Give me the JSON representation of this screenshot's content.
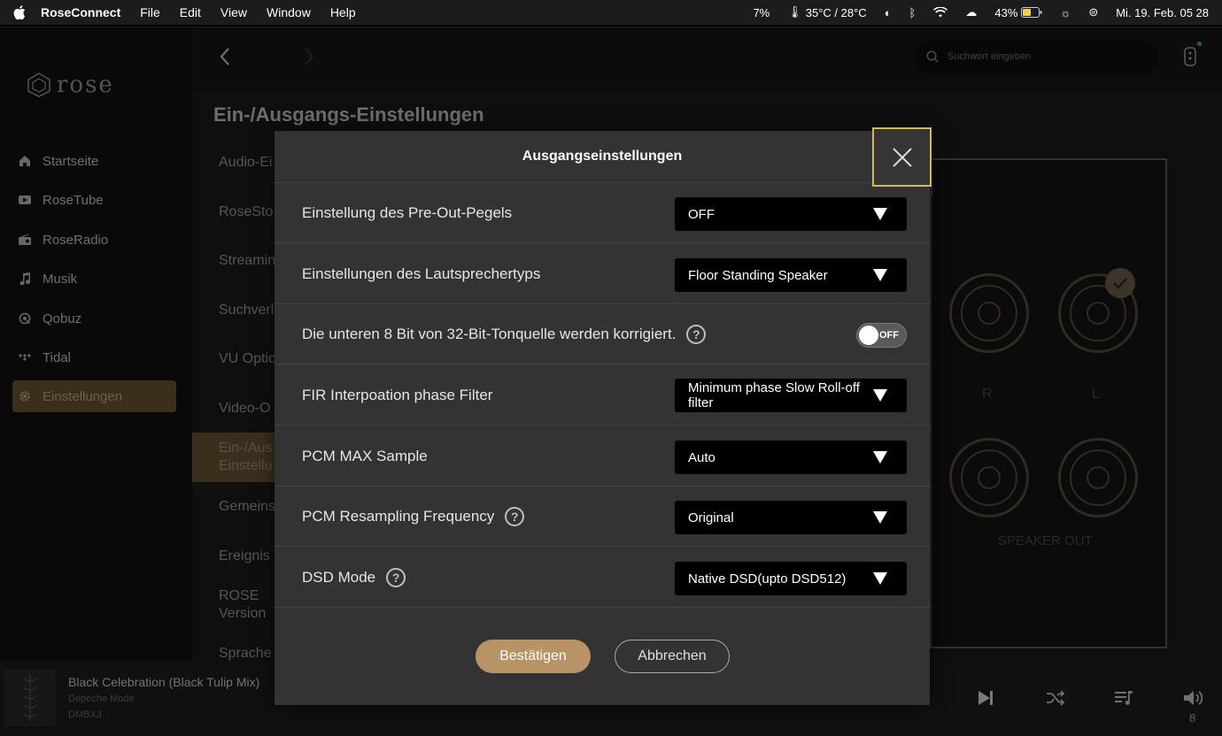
{
  "menubar": {
    "app_name": "RoseConnect",
    "menus": [
      "File",
      "Edit",
      "View",
      "Window",
      "Help"
    ],
    "cpu": "7%",
    "temperature": "35°C / 28°C",
    "battery": "43%",
    "datetime": "Mi. 19. Feb. 05 28"
  },
  "app": {
    "logo_text": "rose",
    "search_placeholder": "Suchwort eingeben",
    "page_title": "Ein-/Ausgangs-Einstellungen"
  },
  "sidebar": {
    "items": [
      {
        "label": "Startseite",
        "icon": "home-icon"
      },
      {
        "label": "RoseTube",
        "icon": "video-icon"
      },
      {
        "label": "RoseRadio",
        "icon": "radio-icon"
      },
      {
        "label": "Musik",
        "icon": "music-icon"
      },
      {
        "label": "Qobuz",
        "icon": "qobuz-icon"
      },
      {
        "label": "Tidal",
        "icon": "tidal-icon"
      },
      {
        "label": "Einstellungen",
        "icon": "gear-icon",
        "active": true
      }
    ]
  },
  "settings_menu": {
    "items": [
      "Audio-Ei",
      "RoseSto",
      "Streamin",
      "Suchverl",
      "VU Optio",
      "Video-O",
      "Ein-/Aus\nEinstellu",
      "Gemeins",
      "Ereignis",
      "ROSE\nVersion",
      "Sprache"
    ]
  },
  "device": {
    "r_label": "R",
    "l_label": "L",
    "speaker_out": "SPEAKER OUT"
  },
  "player": {
    "track_title": "Black Celebration (Black Tulip Mix)",
    "artist": "Depeche Mode",
    "album": "DMBX3",
    "volume": "8"
  },
  "modal": {
    "title": "Ausgangseinstellungen",
    "rows": [
      {
        "label": "Einstellung des Pre-Out-Pegels",
        "value": "OFF"
      },
      {
        "label": "Einstellungen des Lautsprechertyps",
        "value": "Floor Standing Speaker"
      },
      {
        "label": "Die unteren 8 Bit von 32-Bit-Tonquelle werden korrigiert.",
        "toggle": "OFF"
      },
      {
        "label": "FIR Interpoation phase Filter",
        "value": "Minimum phase Slow Roll-off filter"
      },
      {
        "label": "PCM MAX Sample",
        "value": "Auto"
      },
      {
        "label": "PCM Resampling Frequency",
        "value": "Original"
      },
      {
        "label": "DSD Mode",
        "value": "Native DSD(upto DSD512)"
      }
    ],
    "confirm_label": "Bestätigen",
    "cancel_label": "Abbrechen"
  }
}
